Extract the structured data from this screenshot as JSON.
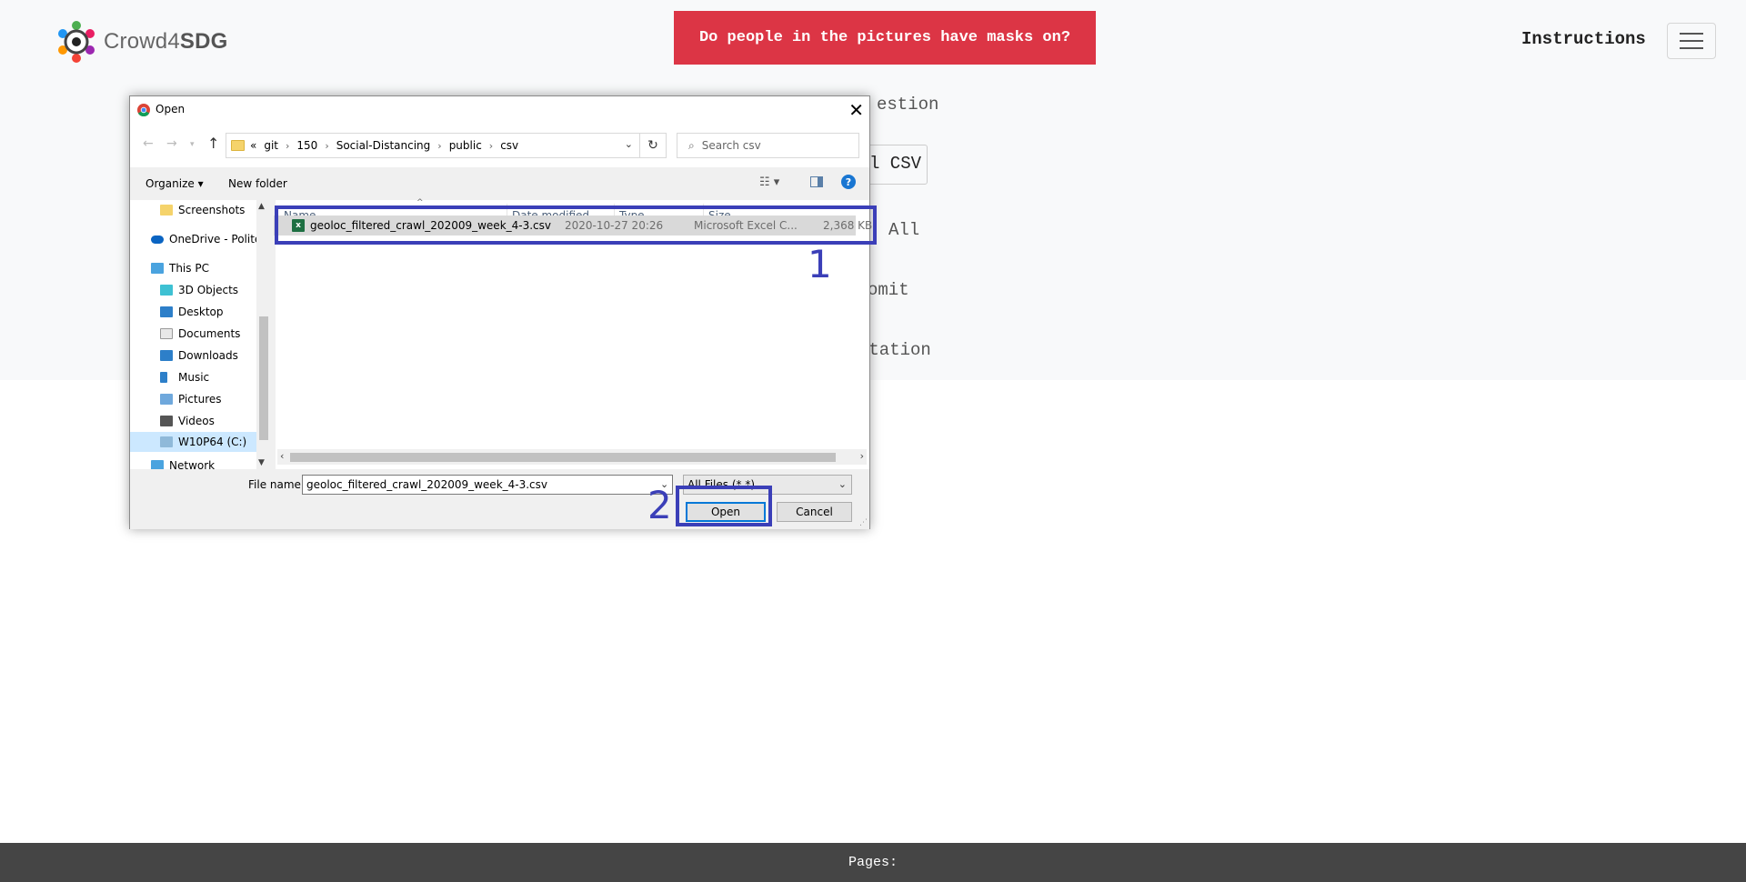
{
  "header": {
    "brand_prefix": "Crowd4",
    "brand_bold": "SDG",
    "question": "Do people in the pictures have masks on?",
    "instructions": "Instructions",
    "accent": "#dc3545"
  },
  "page_partial": {
    "line1": "estion",
    "line2": "l CSV",
    "line3": "All",
    "line4": "omit",
    "line5": "ntation"
  },
  "footer": {
    "pages_label": "Pages:"
  },
  "dialog": {
    "title": "Open",
    "breadcrumb": [
      "«",
      "git",
      "150",
      "Social-Distancing",
      "public",
      "csv"
    ],
    "search_placeholder": "Search csv",
    "toolbar": {
      "organize": "Organize",
      "new_folder": "New folder"
    },
    "sidebar": [
      {
        "label": "Screenshots",
        "icon": "folder-icon"
      },
      {
        "label": "OneDrive - Politec",
        "icon": "cloud-icon"
      },
      {
        "label": "This PC",
        "icon": "computer-icon"
      },
      {
        "label": "3D Objects",
        "icon": "cube-icon"
      },
      {
        "label": "Desktop",
        "icon": "desktop-icon"
      },
      {
        "label": "Documents",
        "icon": "documents-icon"
      },
      {
        "label": "Downloads",
        "icon": "download-icon"
      },
      {
        "label": "Music",
        "icon": "music-icon"
      },
      {
        "label": "Pictures",
        "icon": "pictures-icon"
      },
      {
        "label": "Videos",
        "icon": "videos-icon"
      },
      {
        "label": "W10P64 (C:)",
        "icon": "drive-icon"
      },
      {
        "label": "Network",
        "icon": "network-icon"
      }
    ],
    "columns": [
      "Name",
      "Date modified",
      "Type",
      "Size"
    ],
    "file": {
      "name": "geoloc_filtered_crawl_202009_week_4-3.csv",
      "date": "2020-10-27 20:26",
      "type": "Microsoft Excel C...",
      "size": "2,368 KB"
    },
    "file_name_label": "File name:",
    "file_name_value": "geoloc_filtered_crawl_202009_week_4-3.csv",
    "filter": "All Files (*.*)",
    "open_button": "Open",
    "cancel_button": "Cancel"
  },
  "annotations": {
    "step1": "1",
    "step2": "2",
    "color": "#3b3fb8"
  }
}
